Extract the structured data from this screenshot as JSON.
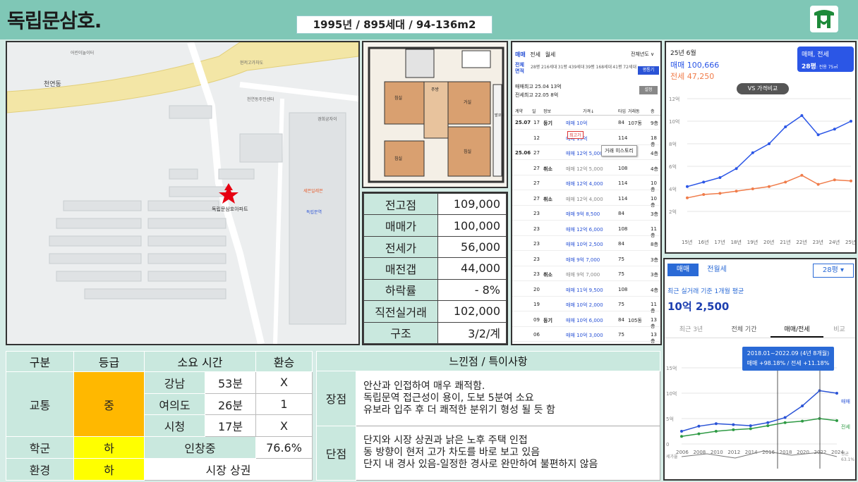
{
  "header": {
    "title": "독립문삼호.",
    "summary": "1995년 / 895세대 / 94-136m2"
  },
  "map": {
    "complex_label": "독립문삼호아파트",
    "labels": [
      "천연동",
      "어린이놀이터",
      "천연동주민센터",
      "경희궁자이",
      "세븐일레븐",
      "독립문역",
      "현저고가차도"
    ]
  },
  "floorplan": {
    "rooms": [
      "침실",
      "주방",
      "거실",
      "침실",
      "침실",
      "발코니"
    ]
  },
  "price_table": {
    "rows": [
      {
        "label": "전고점",
        "value": "109,000"
      },
      {
        "label": "매매가",
        "value": "100,000"
      },
      {
        "label": "전세가",
        "value": "56,000"
      },
      {
        "label": "매전갭",
        "value": "44,000"
      },
      {
        "label": "하락률",
        "value": "- 8%"
      },
      {
        "label": "직전실거래",
        "value": "102,000"
      },
      {
        "label": "구조",
        "value": "3/2/계"
      }
    ]
  },
  "deals": {
    "tabs": [
      "매매",
      "전세",
      "월세"
    ],
    "year_filter": "전체년도 ∨",
    "area_label": "전체 면적",
    "areas": [
      "28평 216세대",
      "31평 439세대",
      "39평 168세대",
      "41평 72세대"
    ],
    "ratio_button": "평통기",
    "recent_sale": "매매최고 25.04 13억",
    "recent_jeonse": "전세최고 22.05 8억",
    "settings": "설정",
    "columns": [
      "계약",
      "일",
      "정보",
      "가격↓",
      "타입",
      "거래동",
      "층"
    ],
    "tooltip": "거래 히스토리",
    "badge": "최고가",
    "rows": [
      {
        "ym": "25.07",
        "d": "17",
        "info": "등기",
        "price": "매매 10억",
        "type": "84",
        "dong": "107동",
        "floor": "9층",
        "c": "blue"
      },
      {
        "ym": "",
        "d": "12",
        "info": "",
        "price": "매매 13억",
        "type": "114",
        "dong": "",
        "floor": "18층",
        "c": "blue"
      },
      {
        "ym": "25.06",
        "d": "27",
        "info": "",
        "price": "매매 12억 5,000",
        "type": "108",
        "dong": "",
        "floor": "4층",
        "c": "blue"
      },
      {
        "ym": "",
        "d": "27",
        "info": "취소",
        "price": "매매 12억 5,000",
        "type": "108",
        "dong": "",
        "floor": "4층",
        "c": "gray"
      },
      {
        "ym": "",
        "d": "27",
        "info": "",
        "price": "매매 12억 4,000",
        "type": "114",
        "dong": "",
        "floor": "10층",
        "c": "blue"
      },
      {
        "ym": "",
        "d": "27",
        "info": "취소",
        "price": "매매 12억 4,000",
        "type": "114",
        "dong": "",
        "floor": "10층",
        "c": "gray"
      },
      {
        "ym": "",
        "d": "23",
        "info": "",
        "price": "매매 9억 8,500",
        "type": "84",
        "dong": "",
        "floor": "3층",
        "c": "blue"
      },
      {
        "ym": "",
        "d": "23",
        "info": "",
        "price": "매매 12억 6,000",
        "type": "108",
        "dong": "",
        "floor": "11층",
        "c": "blue"
      },
      {
        "ym": "",
        "d": "23",
        "info": "",
        "price": "매매 10억 2,500",
        "type": "84",
        "dong": "",
        "floor": "8층",
        "c": "blue"
      },
      {
        "ym": "",
        "d": "23",
        "info": "",
        "price": "매매 9억 7,000",
        "type": "75",
        "dong": "",
        "floor": "3층",
        "c": "blue"
      },
      {
        "ym": "",
        "d": "23",
        "info": "취소",
        "price": "매매 9억 7,000",
        "type": "75",
        "dong": "",
        "floor": "3층",
        "c": "gray"
      },
      {
        "ym": "",
        "d": "20",
        "info": "",
        "price": "매매 11억 9,500",
        "type": "108",
        "dong": "",
        "floor": "4층",
        "c": "blue"
      },
      {
        "ym": "",
        "d": "19",
        "info": "",
        "price": "매매 10억 2,000",
        "type": "75",
        "dong": "",
        "floor": "11층",
        "c": "blue"
      },
      {
        "ym": "",
        "d": "09",
        "info": "등기",
        "price": "매매 10억 6,000",
        "type": "84",
        "dong": "105동",
        "floor": "13층",
        "c": "blue"
      },
      {
        "ym": "",
        "d": "06",
        "info": "",
        "price": "매매 10억 3,000",
        "type": "75",
        "dong": "",
        "floor": "13층",
        "c": "blue"
      }
    ]
  },
  "trend": {
    "month": "25년 6월",
    "sale": "매매 100,666",
    "jeonse": "전세 47,250",
    "filter_type": "매매, 전세",
    "filter_size": "28평",
    "filter_size_sub": ": 전용 75㎡",
    "vs_button": "VS 가격비교",
    "sale_color": "#2b56e6",
    "jeonse_color": "#f07c4a"
  },
  "history": {
    "tab_sale": "매매",
    "tab_rent": "전월세",
    "size": "28평",
    "caption": "최근 실거래 기준 1개월 평균",
    "value": "10억 2,500",
    "tabs": [
      "최근 3년",
      "전체 기간",
      "매매/전세",
      "비교"
    ],
    "tooltip_line1": "2018.01~2022.09 (4년 8개월)",
    "tooltip_line2": "매매 +98.18%  /  전세 +11.18%",
    "legend_sale": "매매",
    "legend_jeonse": "전세",
    "legend_volume": "평균",
    "legend_volume_sub": "63.1%",
    "volume_label": "세가율"
  },
  "grade_table": {
    "headers": [
      "구분",
      "등급",
      "소요 시간",
      "환승"
    ],
    "transport_label": "교통",
    "transport_grade": "중",
    "commutes": [
      {
        "dest": "강남",
        "time": "53분",
        "transfer": "X"
      },
      {
        "dest": "여의도",
        "time": "26분",
        "transfer": "1"
      },
      {
        "dest": "시청",
        "time": "17분",
        "transfer": "X"
      }
    ],
    "school_label": "학군",
    "school_grade": "하",
    "school_name": "인창중",
    "school_rate": "76.6%",
    "env_label": "환경",
    "env_grade": "하",
    "env_note": "시장 상권"
  },
  "notes": {
    "header": "느낀점  /  특이사항",
    "pros_label": "장점",
    "pros": [
      "안산과 인접하여 매우 쾌적함.",
      "독립문역 접근성이 용이, 도보 5분여 소요",
      "유보라 입주 후 더 쾌적한 분위기 형성 될 듯 함"
    ],
    "cons_label": "단점",
    "cons": [
      "단지와 시장 상권과 낡은 노후 주택 인접",
      "동 방향이 현저 고가 차도를 바로 보고 있음",
      "단지 내 경사 있음-일정한 경사로 완만하여 불편하지 않음"
    ]
  },
  "chart_data": [
    {
      "type": "line",
      "x": [
        "15년",
        "16년",
        "17년",
        "18년",
        "19년",
        "20년",
        "21년",
        "22년",
        "23년",
        "24년",
        "25년"
      ],
      "ylim": [
        0,
        12
      ],
      "y_ticks": [
        "2억",
        "4억",
        "6억",
        "8억",
        "10억",
        "12억"
      ],
      "series": [
        {
          "name": "매매",
          "values": [
            4.2,
            4.6,
            5.0,
            5.8,
            7.2,
            8.0,
            9.5,
            10.5,
            8.8,
            9.3,
            10.0
          ]
        },
        {
          "name": "전세",
          "values": [
            3.2,
            3.5,
            3.6,
            3.8,
            4.0,
            4.2,
            4.6,
            5.2,
            4.4,
            4.8,
            4.7
          ]
        }
      ]
    },
    {
      "type": "line",
      "x": [
        "2006",
        "2008",
        "2010",
        "2012",
        "2014",
        "2016",
        "2018",
        "2020",
        "2022",
        "2024"
      ],
      "ylim": [
        0,
        15
      ],
      "y_ticks": [
        "0",
        "5억",
        "10억",
        "15억"
      ],
      "series": [
        {
          "name": "매매",
          "values": [
            2.5,
            3.5,
            4.0,
            3.8,
            3.6,
            4.2,
            5.2,
            7.5,
            10.5,
            10.0
          ]
        },
        {
          "name": "전세",
          "values": [
            1.5,
            2.0,
            2.5,
            2.8,
            3.0,
            3.6,
            4.2,
            4.5,
            5.0,
            4.6
          ]
        }
      ]
    }
  ]
}
